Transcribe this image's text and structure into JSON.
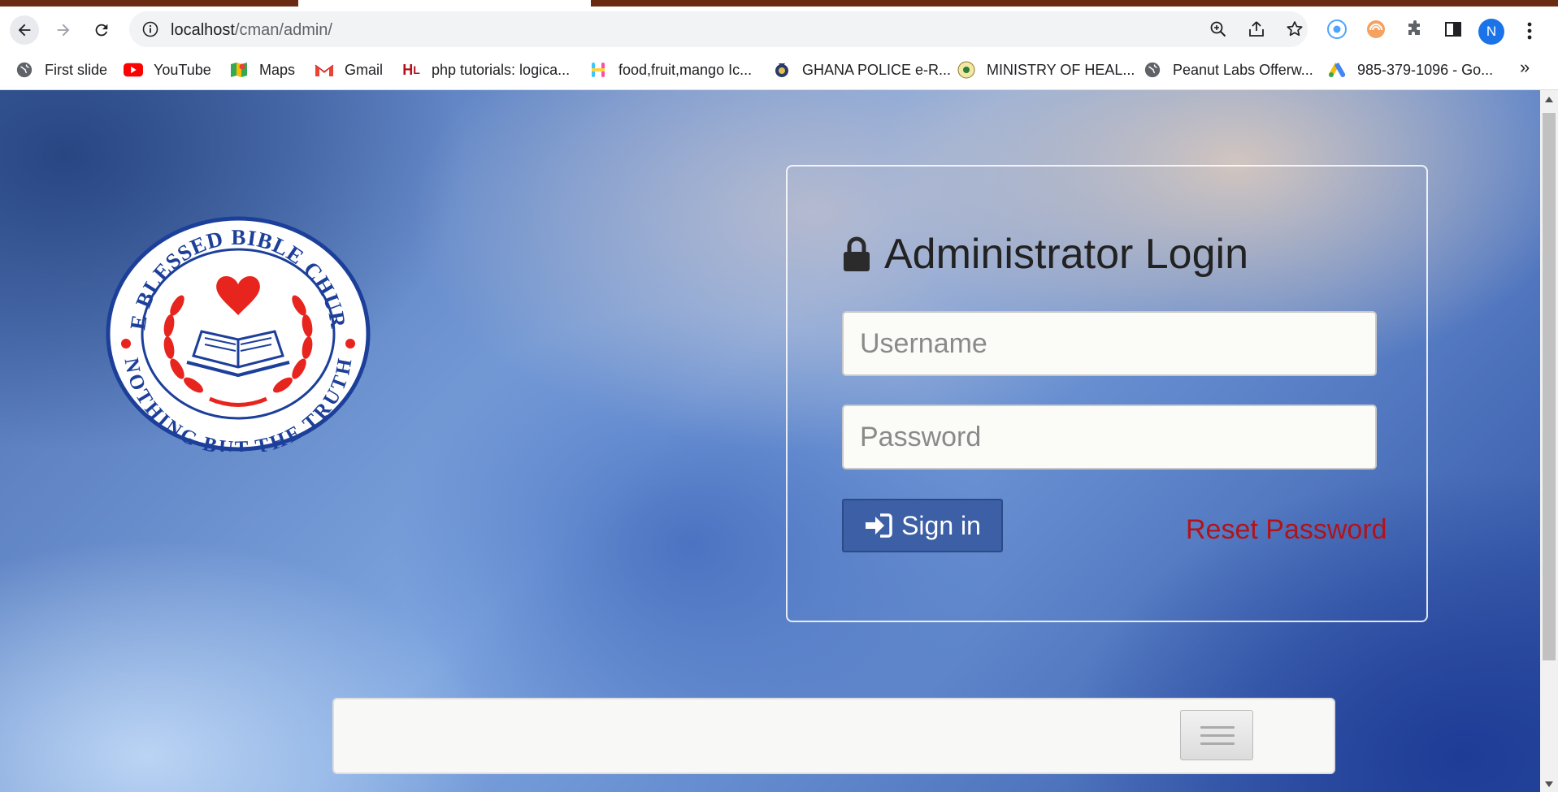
{
  "browser": {
    "url_host": "localhost",
    "url_path": "/cman/admin/",
    "profile_initial": "N",
    "bookmarks": [
      {
        "label": "First slide",
        "icon": "globe-icon"
      },
      {
        "label": "YouTube",
        "icon": "youtube-icon"
      },
      {
        "label": "Maps",
        "icon": "maps-icon"
      },
      {
        "label": "Gmail",
        "icon": "gmail-icon"
      },
      {
        "label": "php tutorials: logica...",
        "icon": "hl-icon"
      },
      {
        "label": "food,fruit,mango Ic...",
        "icon": "h-logo-icon"
      },
      {
        "label": "GHANA POLICE e-R...",
        "icon": "police-badge-icon"
      },
      {
        "label": "MINISTRY OF HEAL...",
        "icon": "ministry-seal-icon"
      },
      {
        "label": "Peanut Labs Offerw...",
        "icon": "globe-icon"
      },
      {
        "label": "985-379-1096 - Go...",
        "icon": "google-ads-icon"
      }
    ],
    "more_label": "»"
  },
  "logo": {
    "top_text": "THE BLESSED BIBLE CHURCH",
    "bottom_text": "NOTHING BUT THE TRUTH"
  },
  "login": {
    "title": "Administrator Login",
    "username_placeholder": "Username",
    "password_placeholder": "Password",
    "signin_label": "Sign in",
    "reset_label": "Reset Password"
  },
  "colors": {
    "accent": "#3d5fa5",
    "reset_link": "#b0141a",
    "logo_blue": "#1c3f9a",
    "logo_red": "#e8241e"
  }
}
